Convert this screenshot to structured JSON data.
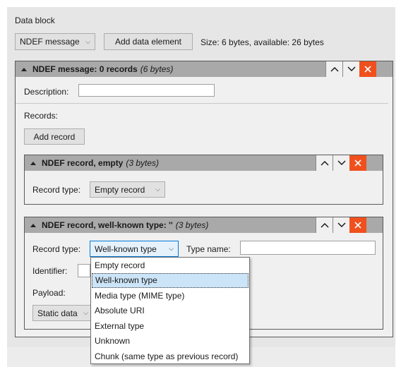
{
  "data_block": {
    "title": "Data block",
    "type_select": "NDEF message",
    "add_element_label": "Add data element",
    "size_text": "Size: 6 bytes, available: 26 bytes"
  },
  "message_panel": {
    "title": "NDEF message: 0 records",
    "bytes": "(6 bytes)",
    "description_label": "Description:",
    "description_value": "",
    "records_label": "Records:",
    "add_record_label": "Add record"
  },
  "record1": {
    "title": "NDEF record, empty",
    "bytes": "(3 bytes)",
    "record_type_label": "Record type:",
    "record_type_value": "Empty record"
  },
  "record2": {
    "title": "NDEF record, well-known type: ''",
    "bytes": "(3 bytes)",
    "record_type_label": "Record type:",
    "record_type_value": "Well-known type",
    "type_name_label": "Type name:",
    "type_name_value": "",
    "identifier_label": "Identifier:",
    "payload_label": "Payload:",
    "payload_select": "Static data"
  },
  "record_type_dropdown": {
    "selected": "Well-known type",
    "options": [
      "Empty record",
      "Well-known type",
      "Media type (MIME type)",
      "Absolute URI",
      "External type",
      "Unknown",
      "Chunk (same type as previous record)"
    ]
  },
  "colors": {
    "panel_header": "#a9a9a9",
    "close_button": "#f0501e",
    "selected_option": "#cce4f7",
    "background": "#e6e6e6"
  },
  "icons": {
    "collapse": "triangle-up-icon",
    "move_up": "chevron-up-icon",
    "move_down": "chevron-down-icon",
    "remove": "close-icon"
  }
}
